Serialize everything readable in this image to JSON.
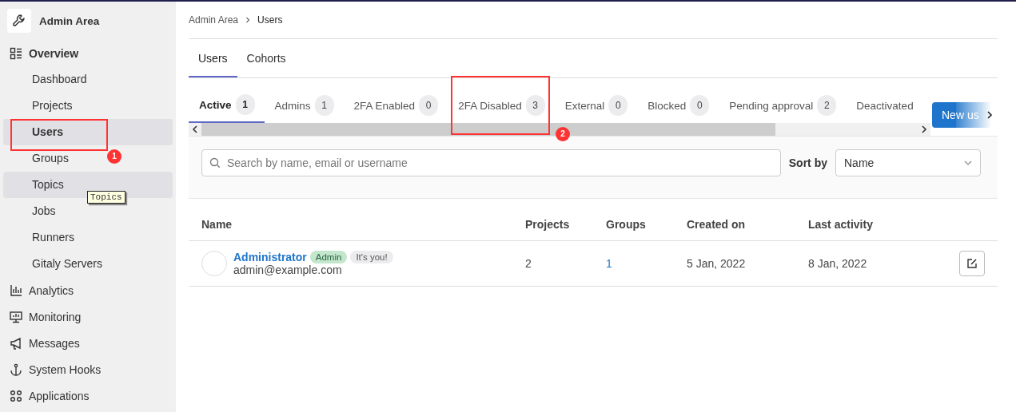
{
  "sidebar": {
    "title": "Admin Area",
    "sections": [
      {
        "label": "Overview",
        "expanded": true,
        "children": [
          {
            "label": "Dashboard",
            "selected": false,
            "hovered": false
          },
          {
            "label": "Projects",
            "selected": false,
            "hovered": false
          },
          {
            "label": "Users",
            "selected": true,
            "hovered": false,
            "annotation": "1"
          },
          {
            "label": "Groups",
            "selected": false,
            "hovered": false
          },
          {
            "label": "Topics",
            "selected": false,
            "hovered": true,
            "tooltip": "Topics"
          },
          {
            "label": "Jobs",
            "selected": false,
            "hovered": false
          },
          {
            "label": "Runners",
            "selected": false,
            "hovered": false
          },
          {
            "label": "Gitaly Servers",
            "selected": false,
            "hovered": false
          }
        ]
      },
      {
        "label": "Analytics",
        "expanded": false
      },
      {
        "label": "Monitoring",
        "expanded": false
      },
      {
        "label": "Messages",
        "expanded": false
      },
      {
        "label": "System Hooks",
        "expanded": false
      },
      {
        "label": "Applications",
        "expanded": false
      }
    ]
  },
  "breadcrumb": [
    "Admin Area",
    "Users"
  ],
  "top_tabs": [
    {
      "label": "Users",
      "selected": true
    },
    {
      "label": "Cohorts",
      "selected": false
    }
  ],
  "filter_tabs": [
    {
      "label": "Active",
      "count": "1",
      "selected": true
    },
    {
      "label": "Admins",
      "count": "1",
      "selected": false
    },
    {
      "label": "2FA Enabled",
      "count": "0",
      "selected": false
    },
    {
      "label": "2FA Disabled",
      "count": "3",
      "selected": false,
      "annotation": "2"
    },
    {
      "label": "External",
      "count": "0",
      "selected": false
    },
    {
      "label": "Blocked",
      "count": "0",
      "selected": false
    },
    {
      "label": "Pending approval",
      "count": "2",
      "selected": false
    },
    {
      "label": "Deactivated",
      "selected": false
    }
  ],
  "new_user_button": "New us",
  "search": {
    "placeholder": "Search by name, email or username"
  },
  "sort": {
    "label": "Sort by",
    "value": "Name"
  },
  "table": {
    "columns": [
      "Name",
      "Projects",
      "Groups",
      "Created on",
      "Last activity"
    ],
    "rows": [
      {
        "name": "Administrator",
        "badges": [
          {
            "text": "Admin",
            "kind": "role"
          },
          {
            "text": "It's you!",
            "kind": "self"
          }
        ],
        "email": "admin@example.com",
        "projects": "2",
        "groups": "1",
        "created_on": "5 Jan, 2022",
        "last_activity": "8 Jan, 2022"
      }
    ]
  }
}
